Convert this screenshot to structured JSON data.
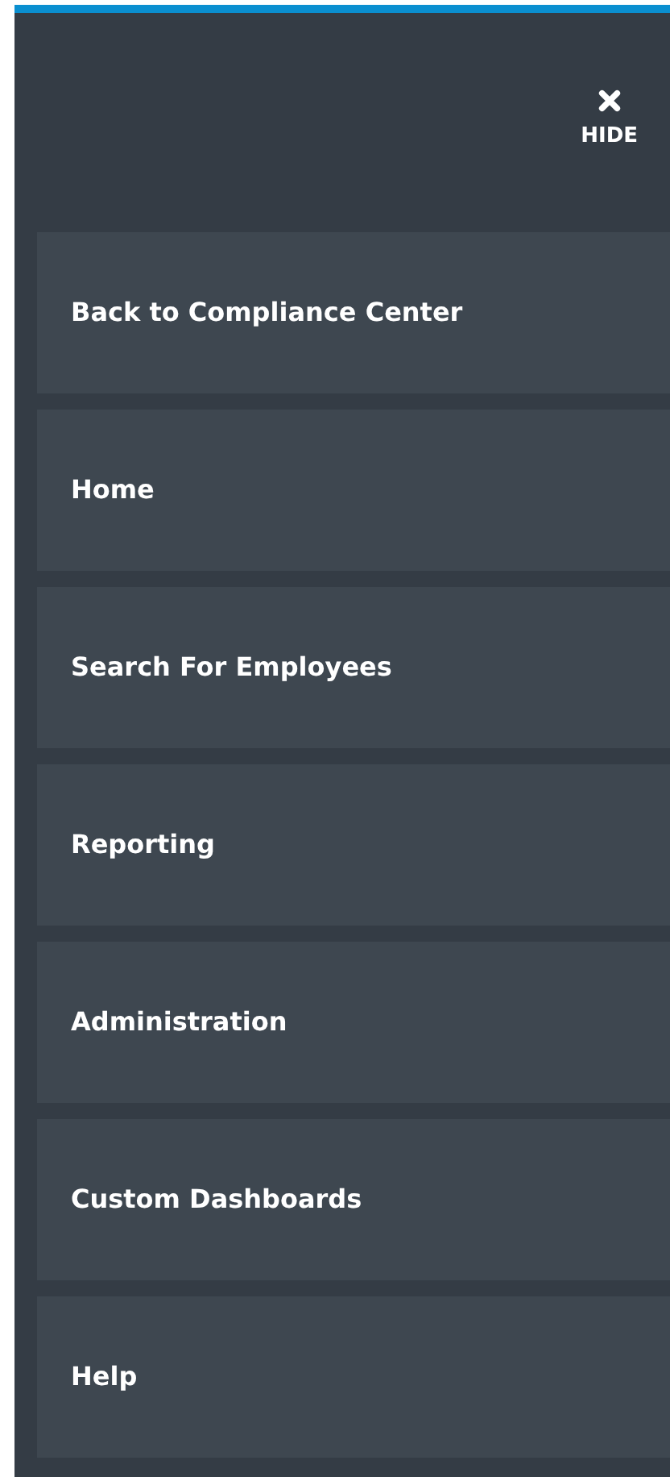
{
  "hide_button": {
    "label": "HIDE"
  },
  "menu_items": [
    {
      "label": "Back to Compliance Center"
    },
    {
      "label": "Home"
    },
    {
      "label": "Search For Employees"
    },
    {
      "label": "Reporting"
    },
    {
      "label": "Administration"
    },
    {
      "label": "Custom Dashboards"
    },
    {
      "label": "Help"
    }
  ]
}
